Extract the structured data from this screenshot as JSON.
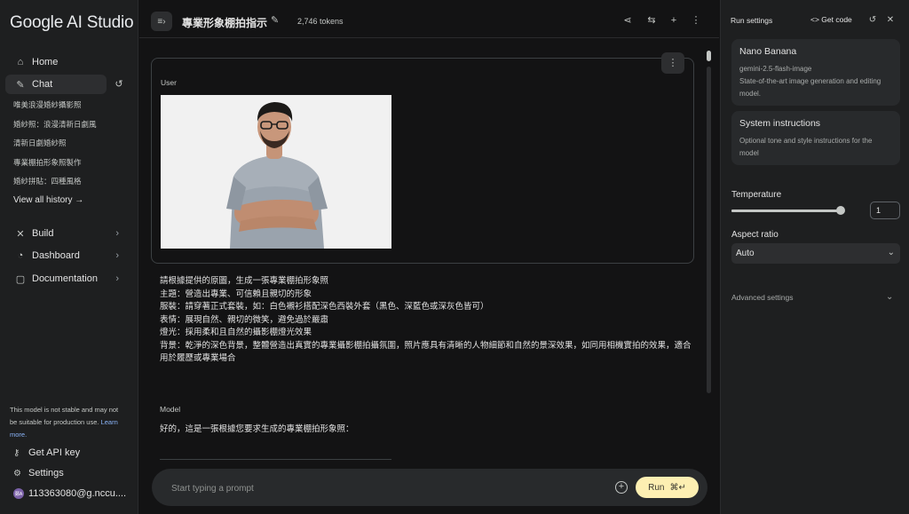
{
  "sidebar": {
    "logo": "Google AI Studio",
    "nav": [
      {
        "label": "Home",
        "icon": "home-icon"
      },
      {
        "label": "Chat",
        "icon": "chat-icon"
      }
    ],
    "history": [
      "唯美浪漫婚紗攝影照",
      "婚紗照：浪漫清新日劇風",
      "清新日劇婚紗照",
      "專業棚拍形象照製作",
      "婚紗拼貼：四種風格"
    ],
    "view_all": "View all history →",
    "sections": [
      {
        "label": "Build",
        "icon": "build-icon"
      },
      {
        "label": "Dashboard",
        "icon": "dashboard-icon"
      },
      {
        "label": "Documentation",
        "icon": "documentation-icon"
      }
    ],
    "warning": "This model is not stable and may not be suitable for production use.",
    "warning_link": "Learn more.",
    "api_key": "Get API key",
    "settings": "Settings",
    "account": "113363080@g.nccu....",
    "avatar_initials": "鄭A"
  },
  "header": {
    "title": "專業形象棚拍指示",
    "tokens": "2,746 tokens"
  },
  "chat": {
    "user_label": "User",
    "prompt_lines": [
      "請根據提供的原圖，生成一張專業棚拍形象照",
      "主題：營造出專業、可信賴且親切的形象",
      "服裝：請穿著正式套裝，如：白色襯衫搭配深色西裝外套（黑色、深藍色或深灰色皆可）",
      "表情：展現自然、親切的微笑，避免過於嚴肅",
      "燈光：採用柔和且自然的攝影棚燈光效果",
      "背景：乾淨的深色背景，整體營造出真實的專業攝影棚拍攝氛圍，照片應具有清晰的人物細節和自然的景深效果，如同用相機實拍的效果，適合用於履歷或專業場合"
    ],
    "model_label": "Model",
    "model_reply": "好的，這是一張根據您要求生成的專業棚拍形象照："
  },
  "prompt": {
    "placeholder": "Start typing a prompt",
    "run_label": "Run",
    "run_shortcut": "⌘↵"
  },
  "run_settings": {
    "title": "Run settings",
    "get_code": "<> Get code",
    "model": {
      "name": "Nano Banana",
      "id": "gemini-2.5-flash-image",
      "desc": "State-of-the-art image generation and editing model."
    },
    "system_instructions": {
      "title": "System instructions",
      "desc": "Optional tone and style instructions for the model"
    },
    "temperature_label": "Temperature",
    "temperature_value": "1",
    "temperature_fraction": 0.5,
    "aspect_ratio_label": "Aspect ratio",
    "aspect_ratio_value": "Auto",
    "advanced": "Advanced settings"
  },
  "colors": {
    "run_button": "#fdefb2",
    "link": "#8ab4f8",
    "background": "#131314",
    "panel": "#1e1f20"
  }
}
